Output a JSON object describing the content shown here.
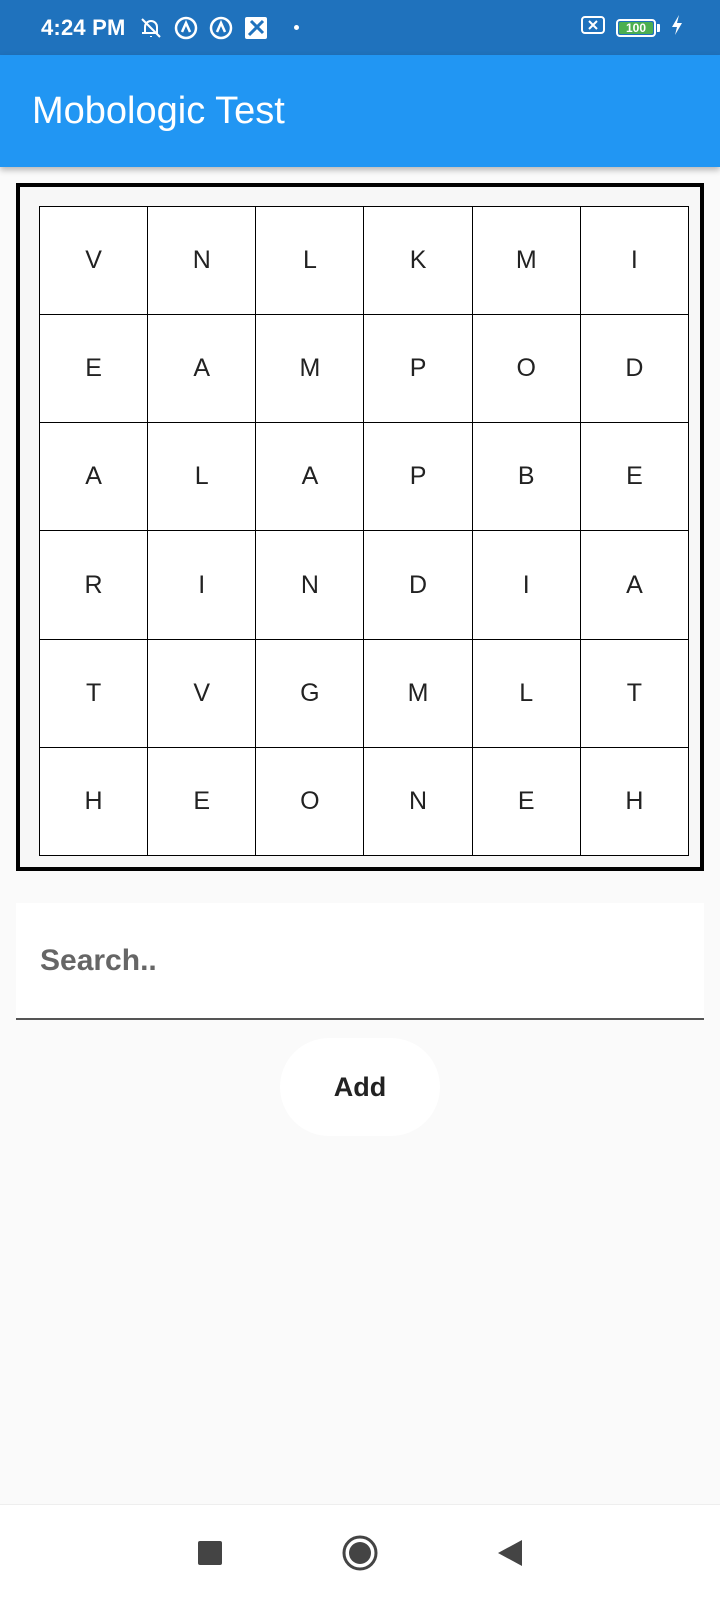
{
  "status_bar": {
    "time": "4:24 PM",
    "battery_level": "100",
    "icons_left": [
      "mute-bell-icon",
      "circle-a-icon",
      "circle-a-icon",
      "app-icon"
    ],
    "icons_right": [
      "sim-x-icon",
      "battery-icon",
      "charging-icon"
    ]
  },
  "app_bar": {
    "title": "Mobologic Test",
    "color": "#2196f3"
  },
  "grid": {
    "rows": [
      [
        "V",
        "N",
        "L",
        "K",
        "M",
        "I"
      ],
      [
        "E",
        "A",
        "M",
        "P",
        "O",
        "D"
      ],
      [
        "A",
        "L",
        "A",
        "P",
        "B",
        "E"
      ],
      [
        "R",
        "I",
        "N",
        "D",
        "I",
        "A"
      ],
      [
        "T",
        "V",
        "G",
        "M",
        "L",
        "T"
      ],
      [
        "H",
        "E",
        "O",
        "N",
        "E",
        "H"
      ]
    ]
  },
  "search": {
    "placeholder": "Search..",
    "value": ""
  },
  "add_button": {
    "label": "Add"
  },
  "nav_bar": {
    "buttons": [
      "recents-square-icon",
      "home-circle-icon",
      "back-triangle-icon"
    ]
  }
}
